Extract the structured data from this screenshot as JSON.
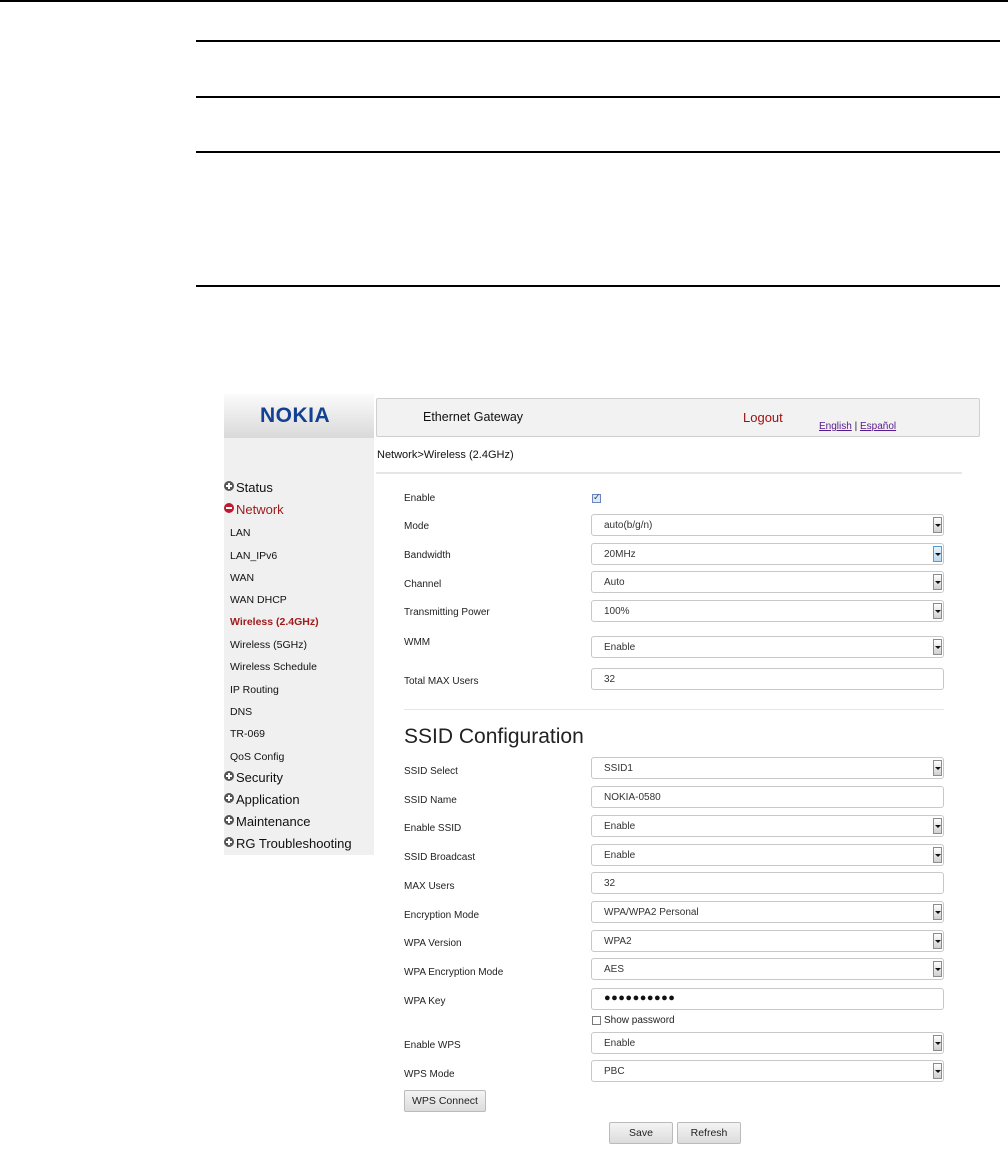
{
  "header": {
    "logo": "NOKIA",
    "gateway_title": "Ethernet Gateway",
    "logout": "Logout",
    "lang_english": "English",
    "lang_separator": "|",
    "lang_spanish": "Español"
  },
  "breadcrumb": "Network>Wireless (2.4GHz)",
  "sidebar": {
    "status": "Status",
    "network": "Network",
    "network_items": [
      "LAN",
      "LAN_IPv6",
      "WAN",
      "WAN DHCP",
      "Wireless (2.4GHz)",
      "Wireless (5GHz)",
      "Wireless Schedule",
      "IP Routing",
      "DNS",
      "TR-069",
      "QoS Config"
    ],
    "security": "Security",
    "application": "Application",
    "maintenance": "Maintenance",
    "rg_troubleshooting": "RG Troubleshooting"
  },
  "wireless": {
    "enable_label": "Enable",
    "enable_checked": true,
    "mode_label": "Mode",
    "mode_value": "auto(b/g/n)",
    "bandwidth_label": "Bandwidth",
    "bandwidth_value": "20MHz",
    "channel_label": "Channel",
    "channel_value": "Auto",
    "power_label": "Transmitting Power",
    "power_value": "100%",
    "wmm_label": "WMM",
    "wmm_value": "Enable",
    "total_users_label": "Total MAX Users",
    "total_users_value": "32"
  },
  "ssid": {
    "section_title": "SSID Configuration",
    "select_label": "SSID Select",
    "select_value": "SSID1",
    "name_label": "SSID Name",
    "name_value": "NOKIA-0580",
    "enable_label": "Enable SSID",
    "enable_value": "Enable",
    "broadcast_label": "SSID Broadcast",
    "broadcast_value": "Enable",
    "max_users_label": "MAX Users",
    "max_users_value": "32",
    "encryption_label": "Encryption Mode",
    "encryption_value": "WPA/WPA2 Personal",
    "wpa_version_label": "WPA Version",
    "wpa_version_value": "WPA2",
    "wpa_enc_label": "WPA Encryption Mode",
    "wpa_enc_value": "AES",
    "wpa_key_label": "WPA Key",
    "wpa_key_value": "●●●●●●●●●●",
    "show_password_label": "Show password",
    "enable_wps_label": "Enable WPS",
    "enable_wps_value": "Enable",
    "wps_mode_label": "WPS Mode",
    "wps_mode_value": "PBC",
    "wps_connect": "WPS Connect"
  },
  "actions": {
    "save": "Save",
    "refresh": "Refresh"
  }
}
